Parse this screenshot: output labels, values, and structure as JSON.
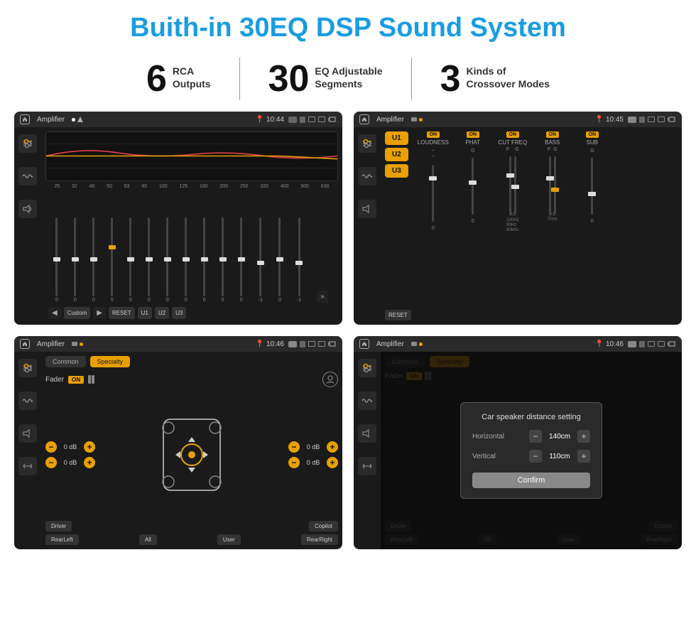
{
  "page": {
    "title": "Buith-in 30EQ DSP Sound System",
    "bg_color": "#ffffff"
  },
  "stats": [
    {
      "number": "6",
      "label": "RCA\nOutputs"
    },
    {
      "number": "30",
      "label": "EQ Adjustable\nSegments"
    },
    {
      "number": "3",
      "label": "Kinds of\nCrossover Modes"
    }
  ],
  "screens": [
    {
      "id": "eq-screen",
      "title": "EQ Screen",
      "status_bar": {
        "app": "Amplifier",
        "time": "10:44"
      },
      "eq_bands": [
        "25",
        "32",
        "40",
        "50",
        "63",
        "80",
        "100",
        "125",
        "160",
        "200",
        "250",
        "320",
        "400",
        "500",
        "630"
      ],
      "eq_values": [
        "0",
        "0",
        "0",
        "5",
        "0",
        "0",
        "0",
        "0",
        "0",
        "0",
        "0",
        "-1",
        "0",
        "-1"
      ],
      "preset": "Custom",
      "buttons": [
        "RESET",
        "U1",
        "U2",
        "U3"
      ]
    },
    {
      "id": "crossover-screen",
      "title": "Crossover Screen",
      "status_bar": {
        "app": "Amplifier",
        "time": "10:45"
      },
      "u_buttons": [
        "U1",
        "U2",
        "U3"
      ],
      "channels": [
        {
          "label": "LOUDNESS",
          "on": true
        },
        {
          "label": "PHAT",
          "on": true
        },
        {
          "label": "CUT FREQ",
          "on": true
        },
        {
          "label": "BASS",
          "on": true
        },
        {
          "label": "SUB",
          "on": true
        }
      ],
      "reset_btn": "RESET"
    },
    {
      "id": "fader-screen",
      "title": "Fader Screen",
      "status_bar": {
        "app": "Amplifier",
        "time": "10:46"
      },
      "tabs": [
        "Common",
        "Specialty"
      ],
      "active_tab": "Specialty",
      "fader_label": "Fader",
      "fader_on": true,
      "volumes": [
        {
          "label": "Driver",
          "value": "0 dB"
        },
        {
          "label": "RearLeft",
          "value": "0 dB"
        },
        {
          "label": "Copilot",
          "value": "0 dB"
        },
        {
          "label": "RearRight",
          "value": "0 dB"
        }
      ],
      "bottom_buttons": [
        "Driver",
        "",
        "Copilot",
        "RearLeft",
        "All",
        "User",
        "RearRight"
      ]
    },
    {
      "id": "distance-screen",
      "title": "Distance Setting Screen",
      "status_bar": {
        "app": "Amplifier",
        "time": "10:46"
      },
      "tabs": [
        "Common",
        "Specialty"
      ],
      "modal": {
        "title": "Car speaker distance setting",
        "horizontal_label": "Horizontal",
        "horizontal_value": "140cm",
        "vertical_label": "Vertical",
        "vertical_value": "110cm",
        "confirm_btn": "Confirm"
      },
      "bottom_buttons": [
        "Driver",
        "",
        "Copilot",
        "RearLeft",
        "All",
        "User",
        "RearRight"
      ]
    }
  ]
}
